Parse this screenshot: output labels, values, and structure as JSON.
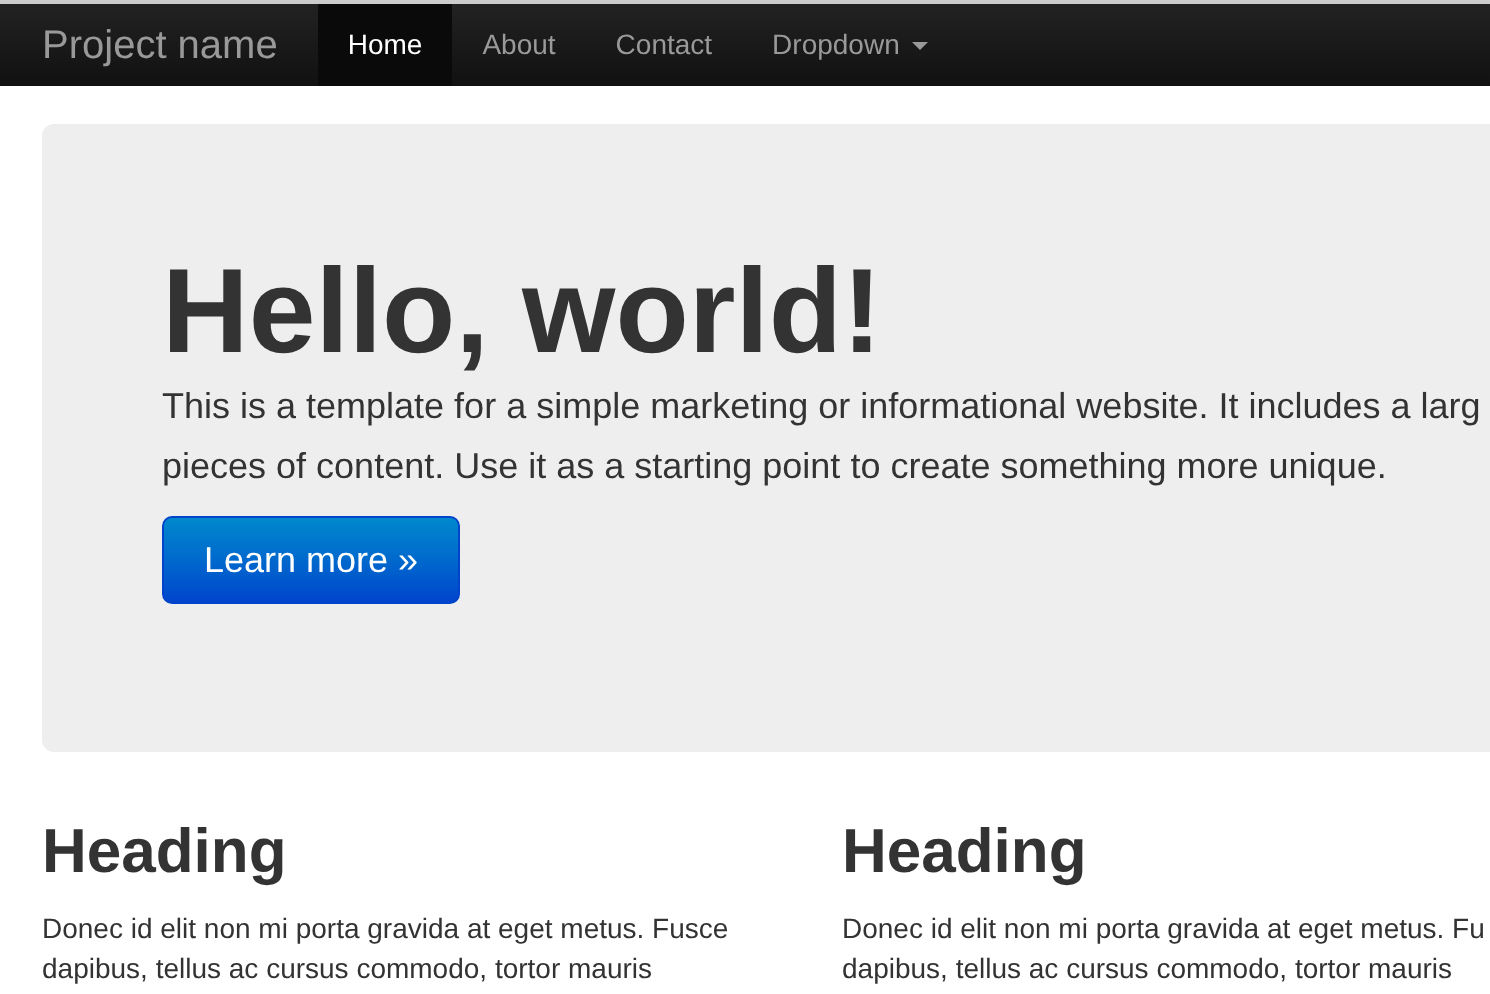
{
  "navbar": {
    "brand": "Project name",
    "items": [
      {
        "label": "Home",
        "selected": true,
        "kind": "link"
      },
      {
        "label": "About",
        "selected": false,
        "kind": "link"
      },
      {
        "label": "Contact",
        "selected": false,
        "kind": "link"
      },
      {
        "label": "Dropdown",
        "selected": false,
        "kind": "dropdown"
      }
    ]
  },
  "hero": {
    "title": "Hello, world!",
    "lines": [
      "This is a template for a simple marketing or informational website. It includes a larg",
      "pieces of content. Use it as a starting point to create something more unique."
    ],
    "button": "Learn more »"
  },
  "columns": [
    {
      "heading": "Heading",
      "lines": [
        "Donec id elit non mi porta gravida at eget metus. Fusce",
        "dapibus, tellus ac cursus commodo, tortor mauris"
      ]
    },
    {
      "heading": "Heading",
      "lines": [
        "Donec id elit non mi porta gravida at eget metus. Fu",
        "dapibus, tellus ac cursus commodo, tortor mauris"
      ]
    }
  ]
}
